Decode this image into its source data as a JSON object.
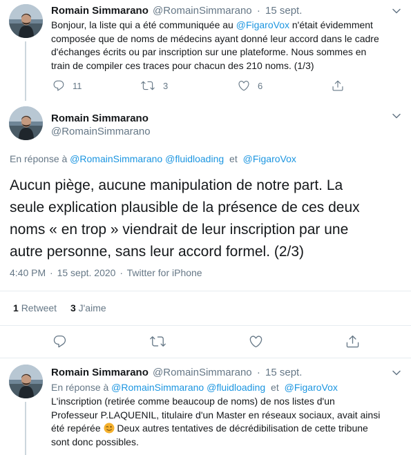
{
  "tweet1": {
    "name": "Romain Simmarano",
    "handle": "@RomainSimmarano",
    "separator": "·",
    "date": "15 sept.",
    "text_lines": [
      [
        "Bonjour, la liste qui a été communiquée au ",
        "@FigaroVox",
        " n'était évidemment"
      ],
      [
        "composée que de noms de médecins ayant donné leur accord dans le cadre"
      ],
      [
        "d'échanges écrits ou par inscription sur une plateforme. Nous sommes en"
      ],
      [
        "train de compiler ces traces pour chacun des 210 noms. (1/3)"
      ]
    ],
    "reply_count": "11",
    "retweet_count": "3",
    "like_count": "6"
  },
  "tweet2": {
    "name": "Romain Simmarano",
    "handle": "@RomainSimmarano",
    "reply_prefix": "En réponse à ",
    "reply_to_1": "@RomainSimmarano",
    "reply_to_2": "@fluidloading",
    "reply_and": "et",
    "reply_to_3": "@FigaroVox",
    "text_lines": [
      "Aucun piège, aucune manipulation de notre part. La",
      "seule explication plausible de la présence de ces deux",
      "noms « en trop » viendrait de leur inscription par une",
      "autre personne, sans leur accord formel. (2/3)"
    ],
    "time": "4:40 PM",
    "separator": "·",
    "date": "15 sept. 2020",
    "source": "Twitter for iPhone",
    "retweets_count": "1",
    "retweets_label": "Retweet",
    "likes_count": "3",
    "likes_label": "J'aime"
  },
  "tweet3": {
    "name": "Romain Simmarano",
    "handle": "@RomainSimmarano",
    "separator": "·",
    "date": "15 sept.",
    "reply_prefix": "En réponse à ",
    "reply_to_1": "@RomainSimmarano",
    "reply_to_2": "@fluidloading",
    "reply_and": "et",
    "reply_to_3": "@FigaroVox",
    "text_lines": [
      "L'inscription (retirée comme beaucoup de noms) de nos listes d'un",
      "Professeur P.LAQUENIL, titulaire d'un Master en réseaux sociaux, avait ainsi",
      "été repérée",
      "Deux autres tentatives de décrédibilisation de cette tribune",
      "sont donc possibles."
    ],
    "emoji": "😉"
  },
  "icons": {
    "reply": "reply-icon",
    "retweet": "retweet-icon",
    "like": "heart-icon",
    "share": "share-icon",
    "more": "chevron-down-icon"
  },
  "colors": {
    "link": "#1b95e0",
    "secondary_text": "#657786",
    "divider": "#e6ecf0",
    "wink_emoji": "#f5b12e"
  }
}
